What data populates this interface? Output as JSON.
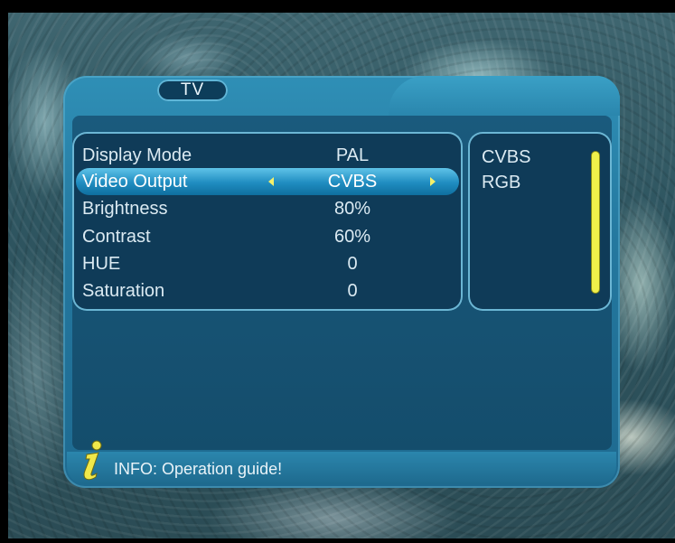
{
  "menu": {
    "title": "TV",
    "rows": [
      {
        "label": "Display Mode",
        "value": "PAL"
      },
      {
        "label": "Video Output",
        "value": "CVBS"
      },
      {
        "label": "Brightness",
        "value": "80%"
      },
      {
        "label": "Contrast",
        "value": "60%"
      },
      {
        "label": "HUE",
        "value": "0"
      },
      {
        "label": "Saturation",
        "value": "0"
      }
    ],
    "selected_row": "Video Output"
  },
  "options": [
    "CVBS",
    "RGB"
  ],
  "info": {
    "text": "INFO: Operation guide!",
    "icon": "info-icon"
  },
  "colors": {
    "panel": "#24789f",
    "selection": "#1f8cc0",
    "scrollbar": "#f0f04a",
    "arrow": "#f4f06a"
  }
}
